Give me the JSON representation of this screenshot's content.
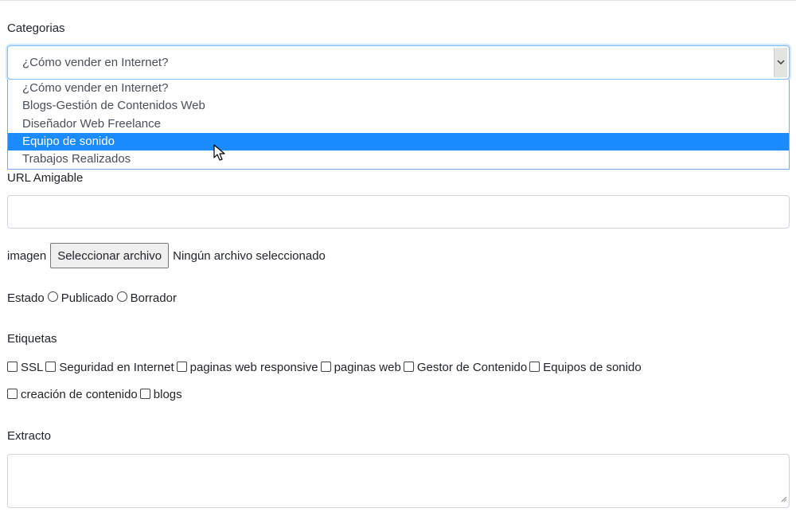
{
  "categorias": {
    "label": "Categorias",
    "selected_value": "¿Cómo vender en Internet?",
    "options": [
      "¿Cómo vender en Internet?",
      "Blogs-Gestión de Contenidos Web",
      "Diseñador Web Freelance",
      "Equipo de sonido",
      "Trabajos Realizados"
    ],
    "highlighted_option": "Equipo de sonido"
  },
  "url_amigable": {
    "label": "URL Amigable",
    "value": ""
  },
  "imagen": {
    "label": "imagen",
    "button_label": "Seleccionar archivo",
    "status": "Ningún archivo seleccionado"
  },
  "estado": {
    "label": "Estado",
    "options": [
      "Publicado",
      "Borrador"
    ]
  },
  "etiquetas": {
    "label": "Etiquetas",
    "items": [
      "SSL",
      "Seguridad en Internet",
      "paginas web responsive",
      "paginas web",
      "Gestor de Contenido",
      "Equipos de sonido",
      "creación de contenido",
      "blogs"
    ]
  },
  "extracto": {
    "label": "Extracto",
    "value": ""
  },
  "colors": {
    "focus_border": "#80bdff",
    "highlight": "#1a8cff",
    "input_border": "#ced4da",
    "text": "#212529"
  },
  "icons": [
    "chevron-down-icon",
    "mouse-pointer-icon",
    "resize-grip-icon"
  ]
}
